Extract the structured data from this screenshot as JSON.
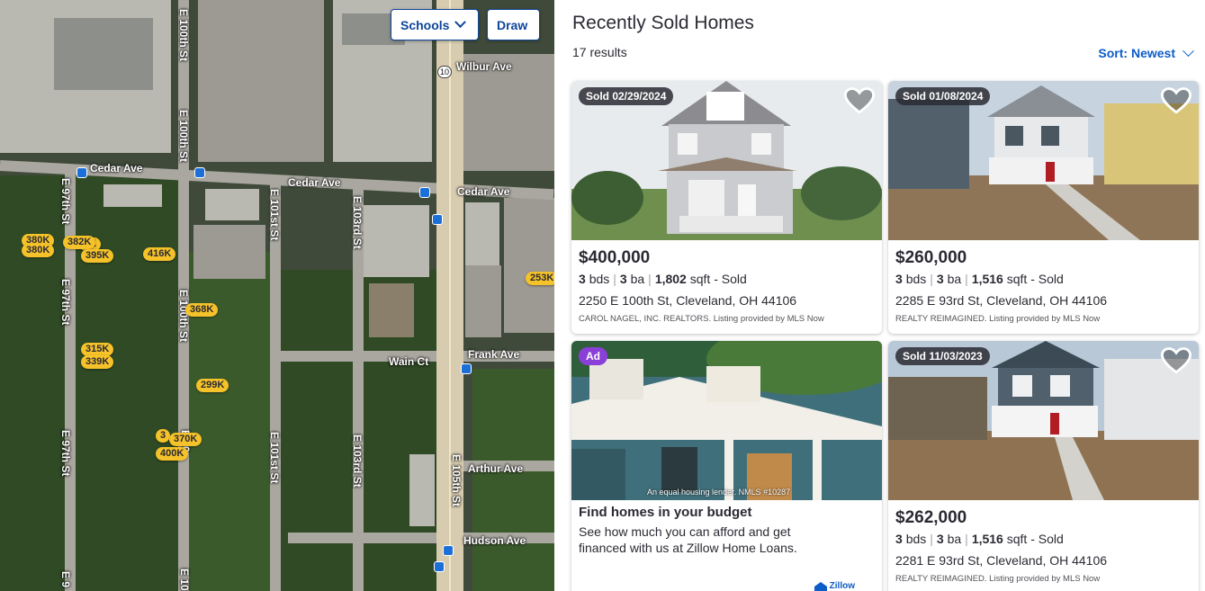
{
  "map": {
    "buttons": {
      "schools": "Schools",
      "draw": "Draw"
    },
    "streets": {
      "cedar_ave_left": "Cedar Ave",
      "cedar_ave_mid": "Cedar Ave",
      "cedar_ave_right": "Cedar Ave",
      "wilbur_ave": "Wilbur Ave",
      "frank_ave": "Frank Ave",
      "wain_ct": "Wain Ct",
      "arthur_ave": "Arthur Ave",
      "hudson_ave": "Hudson Ave",
      "e100th_top": "E 100th St",
      "e100th_mid": "E 100th St",
      "e100th_low": "E 100th St",
      "e100th_bottom": "E 10",
      "e97th_top": "E 97th St",
      "e97th_mid": "E 97th St",
      "e97th_low": "E 97th St",
      "e97th_bottom": "E 9",
      "e101st_top": "E 101st St",
      "e101st_low": "E 101st St",
      "e103rd_top": "E 103rd St",
      "e103rd_low": "E 103rd St",
      "e105th": "E 105th St",
      "route_shield": "10"
    },
    "price_pins": [
      "380K",
      "380K",
      "382K",
      "0K",
      "395K",
      "416K",
      "368K",
      "315K",
      "339K",
      "299K",
      "253K",
      "3",
      "370K",
      "400K"
    ]
  },
  "panel": {
    "title": "Recently Sold Homes",
    "results": "17 results",
    "sort_label": "Sort: Newest"
  },
  "listings": [
    {
      "badge": "Sold 02/29/2024",
      "price": "$400,000",
      "beds": "3",
      "beds_unit": "bds",
      "baths": "3",
      "baths_unit": "ba",
      "sqft": "1,802",
      "sqft_unit": "sqft",
      "status": "- Sold",
      "address": "2250 E 100th St, Cleveland, OH 44106",
      "broker": "CAROL NAGEL, INC. REALTORS. Listing provided by MLS Now"
    },
    {
      "badge": "Sold 01/08/2024",
      "price": "$260,000",
      "beds": "3",
      "beds_unit": "bds",
      "baths": "3",
      "baths_unit": "ba",
      "sqft": "1,516",
      "sqft_unit": "sqft",
      "status": "- Sold",
      "address": "2285 E 93rd St, Cleveland, OH 44106",
      "broker": "REALTY REIMAGINED. Listing provided by MLS Now"
    },
    {
      "badge": "Sold 11/03/2023",
      "price": "$262,000",
      "beds": "3",
      "beds_unit": "bds",
      "baths": "3",
      "baths_unit": "ba",
      "sqft": "1,516",
      "sqft_unit": "sqft",
      "status": "- Sold",
      "address": "2281 E 93rd St, Cleveland, OH 44106",
      "broker": "REALTY REIMAGINED. Listing provided by MLS Now"
    }
  ],
  "ad": {
    "badge": "Ad",
    "disclaimer": "An equal housing lender. NMLS #10287",
    "title": "Find homes in your budget",
    "body": "See how much you can afford and get financed with us at Zillow Home Loans.",
    "logo": "Zillow"
  },
  "colors": {
    "accent": "#0d5cc7",
    "pin": "#f5c229",
    "ad_badge": "#8b3fd9"
  }
}
